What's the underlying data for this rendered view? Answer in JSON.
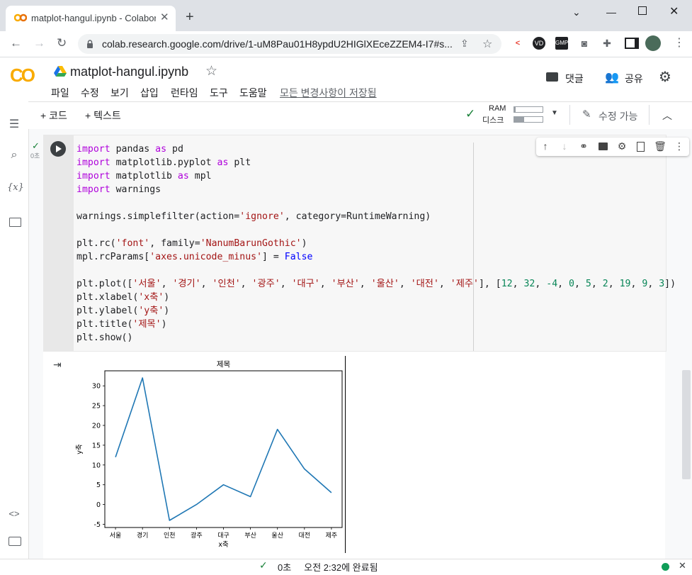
{
  "browser": {
    "tab_title": "matplot-hangul.ipynb - Colabora",
    "url": "colab.research.google.com/drive/1-uM8Pau01H8ypdU2HIGlXEceZZEM4-I7#s...",
    "extensions": [
      "extension-icon",
      "vd-icon",
      "GMP",
      "camera-icon",
      "puzzle-icon",
      "sidepanel-icon",
      "avatar"
    ]
  },
  "colab": {
    "logo": "CO",
    "notebook_title": "matplot-hangul.ipynb",
    "menu": [
      "파일",
      "수정",
      "보기",
      "삽입",
      "런타임",
      "도구",
      "도움말"
    ],
    "saved_status": "모든 변경사항이 저장됨",
    "comment_label": "댓글",
    "share_label": "공유",
    "add_code": "+ 코드",
    "add_text": "+ 텍스트",
    "ram_label": "RAM",
    "disk_label": "디스크",
    "edit_mode": "수정 가능",
    "exec_time": "0초"
  },
  "code_lines": [
    "import pandas as pd",
    "import matplotlib.pyplot as plt",
    "import matplotlib as mpl",
    "import warnings",
    "",
    "warnings.simplefilter(action='ignore', category=RuntimeWarning)",
    "",
    "plt.rc('font', family='NanumBarunGothic')",
    "mpl.rcParams['axes.unicode_minus'] = False",
    "",
    "plt.plot(['서울', '경기', '인천', '광주', '대구', '부산', '울산', '대전', '제주'], [12, 32, -4, 0, 5, 2, 19, 9, 3])",
    "plt.xlabel('x축')",
    "plt.ylabel('y축')",
    "plt.title('제목')",
    "plt.show()"
  ],
  "chart_data": {
    "type": "line",
    "title": "제목",
    "xlabel": "x축",
    "ylabel": "y축",
    "categories": [
      "서울",
      "경기",
      "인천",
      "광주",
      "대구",
      "부산",
      "울산",
      "대전",
      "제주"
    ],
    "values": [
      12,
      32,
      -4,
      0,
      5,
      2,
      19,
      9,
      3
    ],
    "yticks": [
      -5,
      0,
      5,
      10,
      15,
      20,
      25,
      30
    ],
    "ylim": [
      -5.8,
      33.8
    ],
    "color": "#1f77b4",
    "grid": false
  },
  "status": {
    "check": "✓",
    "time": "0초",
    "message": "오전 2:32에 완료됨"
  }
}
